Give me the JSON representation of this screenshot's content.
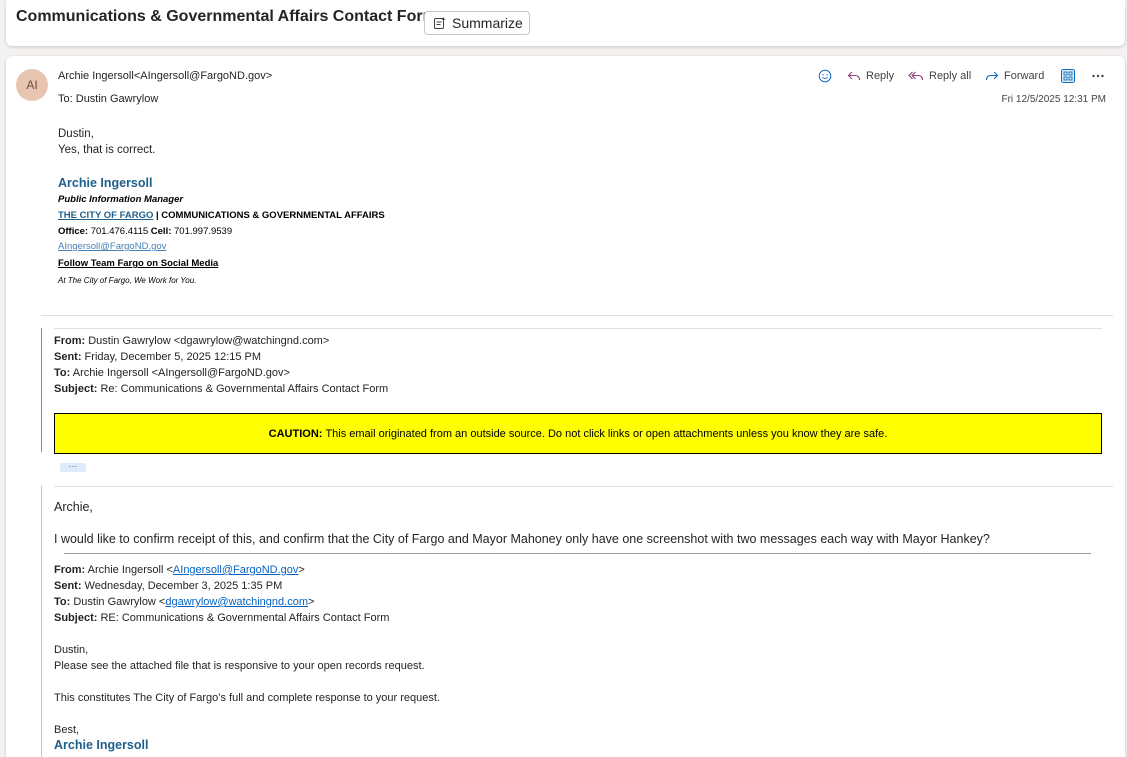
{
  "header": {
    "subject": "Communications & Governmental Affairs Contact Form",
    "summarize_label": "Summarize"
  },
  "message": {
    "avatar_initials": "AI",
    "from": "Archie Ingersoll<AIngersoll@FargoND.gov>",
    "to_label": "To:",
    "to": "Dustin Gawrylow",
    "datetime": "Fri 12/5/2025 12:31 PM",
    "actions": {
      "reply": "Reply",
      "reply_all": "Reply all",
      "forward": "Forward"
    },
    "body": [
      "Dustin,",
      "Yes, that is correct."
    ],
    "signature": {
      "name": "Archie Ingersoll",
      "title": "Public Information Manager",
      "city": "THE CITY OF FARGO",
      "separator": " | ",
      "department": "COMMUNICATIONS & GOVERNMENTAL AFFAIRS",
      "office_label": "Office:",
      "office": " 701.476.4115  ",
      "cell_label": "Cell:",
      "cell": " 701.997.9539",
      "email": "AIngersoll@FargoND.gov",
      "social": "Follow Team Fargo on Social Media",
      "tagline": "At The City of Fargo, We Work for You."
    }
  },
  "quoted1": {
    "from_label": "From:",
    "from": " Dustin Gawrylow <dgawrylow@watchingnd.com>",
    "sent_label": "Sent:",
    "sent": " Friday, December 5, 2025 12:15 PM",
    "to_label": "To:",
    "to": " Archie Ingersoll <AIngersoll@FargoND.gov>",
    "subject_label": "Subject:",
    "subject": " Re: Communications & Governmental Affairs Contact Form",
    "caution_label": "CAUTION:",
    "caution_text": "This email originated from an outside source. Do not click links or open attachments unless you know they are safe.",
    "ellipsis": "···"
  },
  "reply": {
    "greeting": "Archie,",
    "text": "I would like to confirm receipt of this, and confirm that the City of Fargo and Mayor Mahoney only have one screenshot with two messages each way with Mayor Hankey?"
  },
  "quoted2": {
    "from_label": "From:",
    "from_name": " Archie Ingersoll <",
    "from_email": "AIngersoll@FargoND.gov",
    "from_close": ">",
    "sent_label": "Sent:",
    "sent": " Wednesday, December 3, 2025 1:35 PM",
    "to_label": "To:",
    "to_name": " Dustin Gawrylow <",
    "to_email": "dgawrylow@watchingnd.com",
    "to_close": ">",
    "subject_label": "Subject:",
    "subject": " RE: Communications & Governmental Affairs Contact Form",
    "body": [
      "Dustin,",
      "Please see the attached file that is responsive to your open records request.",
      "This constitutes The City of Fargo’s full and complete response to your request.",
      "Best,"
    ],
    "signature_name": "Archie Ingersoll"
  }
}
